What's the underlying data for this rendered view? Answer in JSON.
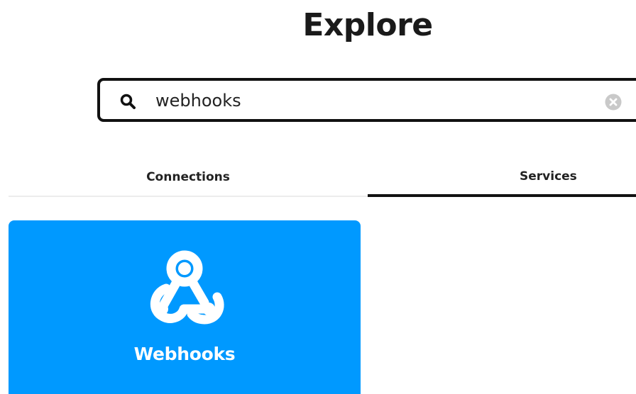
{
  "header": {
    "title": "Explore"
  },
  "search": {
    "value": "webhooks",
    "search_icon": "search-icon",
    "clear_icon": "clear-circle-icon"
  },
  "tabs": [
    {
      "label": "Connections",
      "selected": false
    },
    {
      "label": "Services",
      "selected": true
    }
  ],
  "results": {
    "services": [
      {
        "name": "Webhooks",
        "icon": "webhooks-icon",
        "color": "#0099ff"
      }
    ]
  },
  "colors": {
    "accent": "#0099ff",
    "text": "#222222",
    "selected_tab_underline": "#111111"
  }
}
